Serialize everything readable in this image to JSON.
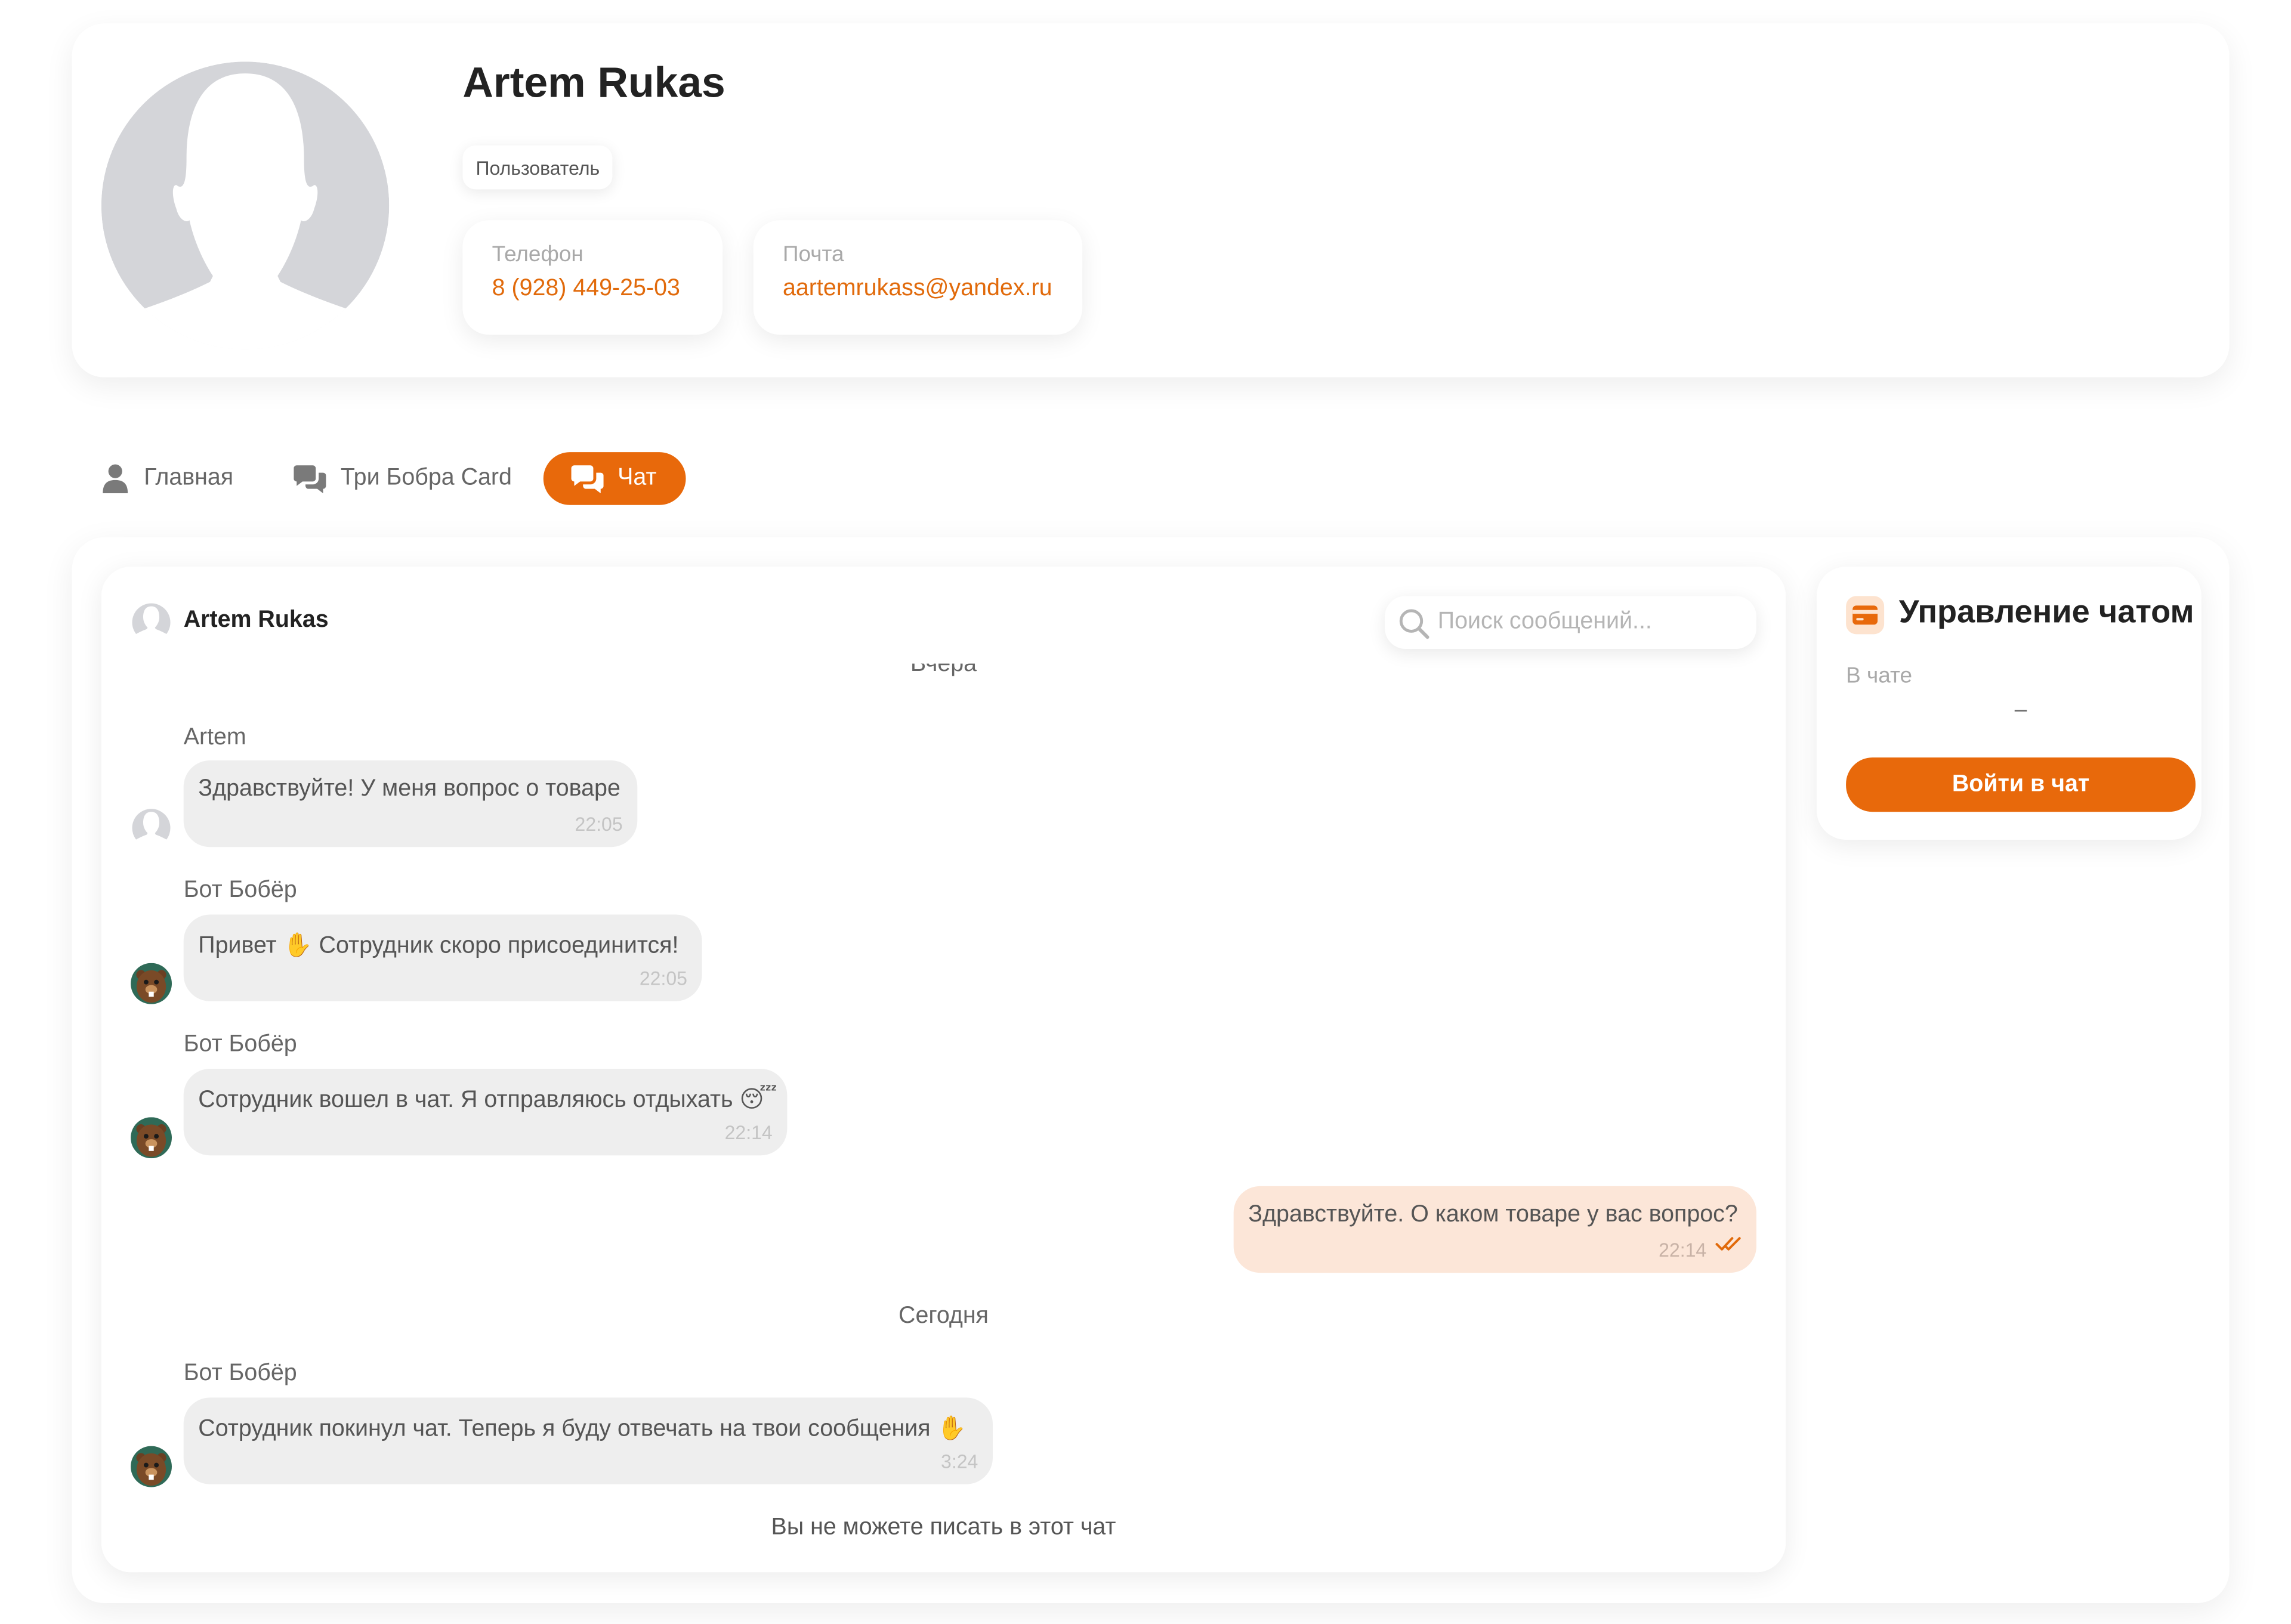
{
  "profile": {
    "name": "Artem Rukas",
    "role": "Пользователь",
    "phone": {
      "label": "Телефон",
      "value": "8 (928) 449-25-03"
    },
    "email": {
      "label": "Почта",
      "value": "aartemrukass@yandex.ru"
    }
  },
  "tabs": [
    {
      "label": "Главная",
      "icon": "user-icon",
      "active": false
    },
    {
      "label": "Три Бобра Card",
      "icon": "chat-bubbles-icon",
      "active": false
    },
    {
      "label": "Чат",
      "icon": "chat-bubbles-icon",
      "active": true
    }
  ],
  "chat": {
    "header": {
      "name": "Artem Rukas",
      "avatar": "avatar-placeholder-icon"
    },
    "search": {
      "placeholder": "Поиск сообщений...",
      "value": "",
      "icon": "search-icon"
    },
    "days": {
      "yesterday": "Вчера",
      "today": "Сегодня"
    },
    "messages": [
      {
        "sender": "Artem",
        "text": "Здравствуйте! У меня вопрос о товаре",
        "time": "22:05",
        "direction": "incoming",
        "avatar": "avatar-placeholder-icon"
      },
      {
        "sender": "Бот Бобёр",
        "text": "Привет ✋ Сотрудник скоро присоединится!",
        "time": "22:05",
        "direction": "incoming",
        "avatar": "beaver-bot-icon"
      },
      {
        "sender": "Бот Бобёр",
        "text": "Сотрудник вошел в чат. Я отправляюсь отдыхать 😴",
        "time": "22:14",
        "direction": "incoming",
        "avatar": "beaver-bot-icon"
      },
      {
        "sender": "",
        "text": "Здравствуйте. О каком товаре у вас вопрос?",
        "time": "22:14",
        "direction": "outgoing",
        "status": "read",
        "status_icon": "double-check-icon"
      },
      {
        "sender": "Бот Бобёр",
        "text": "Сотрудник покинул чат. Теперь я буду отвечать на твои сообщения ✋",
        "time": "3:24",
        "direction": "incoming",
        "avatar": "beaver-bot-icon"
      }
    ],
    "notice": "Вы не можете писать в этот чат"
  },
  "manage": {
    "title": "Управление чатом",
    "icon": "card-icon",
    "in_chat_label": "В чате",
    "in_chat_value": "–",
    "join_button": "Войти в чат"
  },
  "colors": {
    "accent": "#e8690b",
    "link": "#e16a0b",
    "outgoing_bubble": "#fce6d8",
    "incoming_bubble": "#eeeeee",
    "muted_text": "#a9a9a9"
  }
}
